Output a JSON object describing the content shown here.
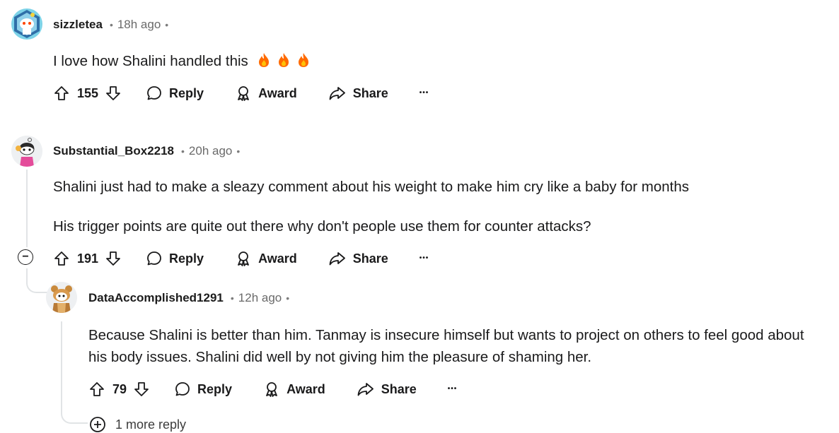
{
  "comments": [
    {
      "username": "sizzletea",
      "time": "18h ago",
      "paragraphs": [
        "I love how Shalini handled this"
      ],
      "votes": "155",
      "reply_label": "Reply",
      "award_label": "Award",
      "share_label": "Share",
      "more_label": "•••"
    },
    {
      "username": "Substantial_Box2218",
      "time": "20h ago",
      "paragraphs": [
        "Shalini just had to make a sleazy comment about his weight to make him cry like a baby for months",
        "His trigger points are quite out there why don't people use them for counter attacks?"
      ],
      "votes": "191",
      "reply_label": "Reply",
      "award_label": "Award",
      "share_label": "Share",
      "more_label": "•••",
      "collapse_symbol": "−"
    },
    {
      "username": "DataAccomplished1291",
      "time": "12h ago",
      "paragraphs": [
        "Because Shalini is better than him. Tanmay is insecure himself but wants to project on others to feel good about his body issues. Shalini did well by not giving him the pleasure of shaming her."
      ],
      "votes": "79",
      "reply_label": "Reply",
      "award_label": "Award",
      "share_label": "Share",
      "more_label": "•••"
    }
  ],
  "more_replies": {
    "label": "1 more reply",
    "icon": "plus-circle-icon"
  },
  "colors": {
    "text": "#1a1a1b",
    "meta": "#6a6a6a",
    "thread_line": "#e1e4e6",
    "flame": "#ff6a00"
  }
}
